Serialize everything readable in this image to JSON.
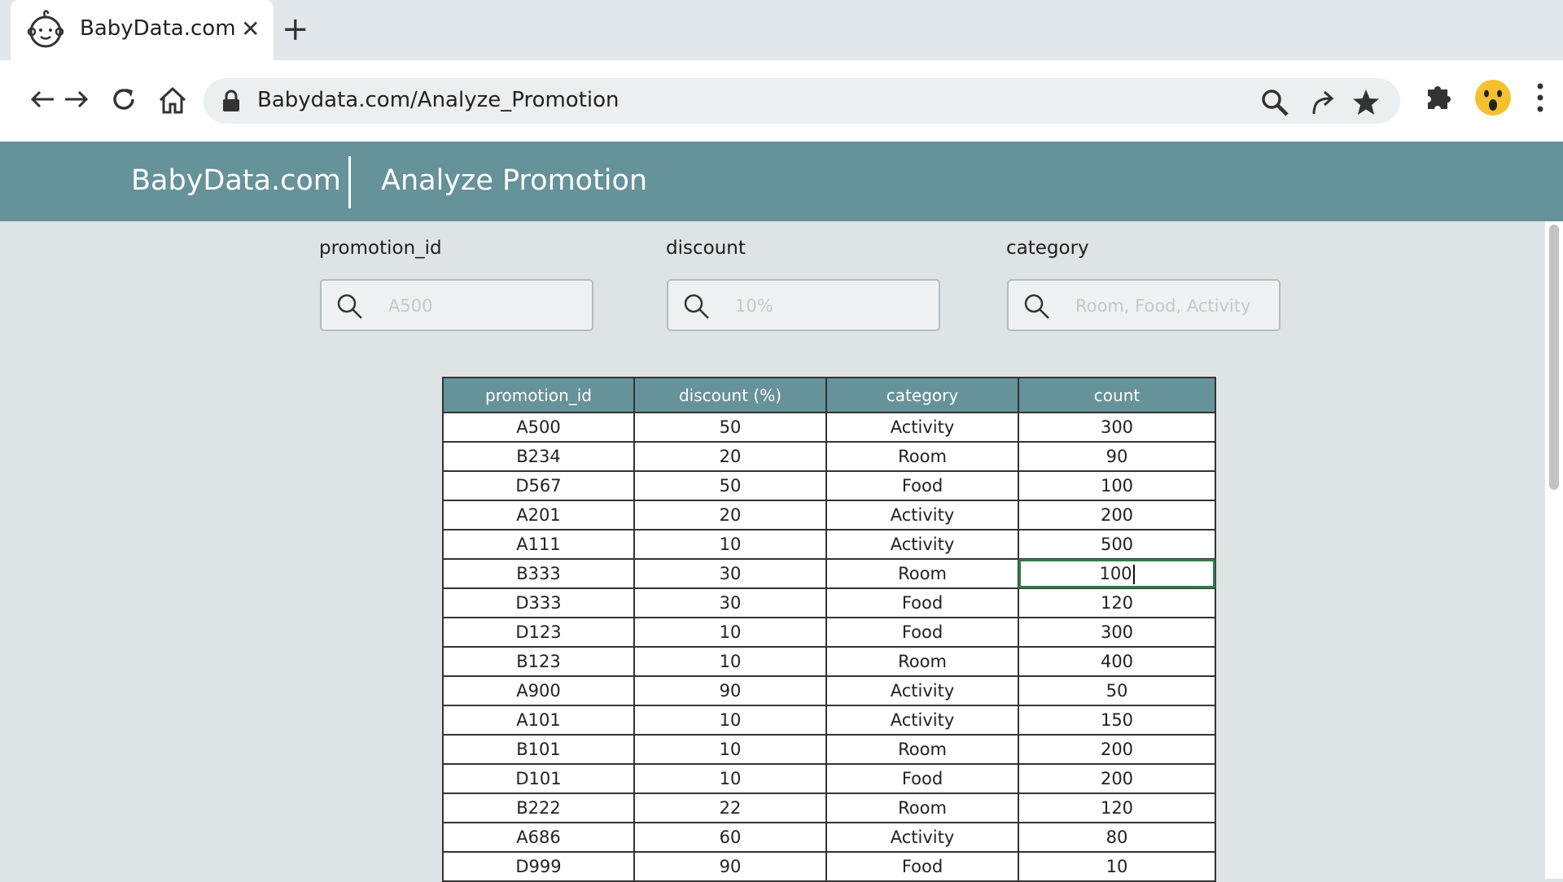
{
  "browser": {
    "tab_title": "BabyData.com",
    "url": "Babydata.com/Analyze_Promotion"
  },
  "header": {
    "brand": "BabyData.com",
    "page_title": "Analyze Promotion"
  },
  "filters": [
    {
      "label": "promotion_id",
      "placeholder": "A500"
    },
    {
      "label": "discount",
      "placeholder": "10%"
    },
    {
      "label": "category",
      "placeholder": "Room, Food, Activity"
    }
  ],
  "table": {
    "columns": [
      "promotion_id",
      "discount (%)",
      "category",
      "count"
    ],
    "rows": [
      [
        "A500",
        "50",
        "Activity",
        "300"
      ],
      [
        "B234",
        "20",
        "Room",
        "90"
      ],
      [
        "D567",
        "50",
        "Food",
        "100"
      ],
      [
        "A201",
        "20",
        "Activity",
        "200"
      ],
      [
        "A111",
        "10",
        "Activity",
        "500"
      ],
      [
        "B333",
        "30",
        "Room",
        "100"
      ],
      [
        "D333",
        "30",
        "Food",
        "120"
      ],
      [
        "D123",
        "10",
        "Food",
        "300"
      ],
      [
        "B123",
        "10",
        "Room",
        "400"
      ],
      [
        "A900",
        "90",
        "Activity",
        "50"
      ],
      [
        "A101",
        "10",
        "Activity",
        "150"
      ],
      [
        "B101",
        "10",
        "Room",
        "200"
      ],
      [
        "D101",
        "10",
        "Food",
        "200"
      ],
      [
        "B222",
        "22",
        "Room",
        "120"
      ],
      [
        "A686",
        "60",
        "Activity",
        "80"
      ],
      [
        "D999",
        "90",
        "Food",
        "10"
      ]
    ]
  },
  "colors": {
    "header_bg": "#66929a",
    "page_bg": "#dee3e5",
    "active_cell_border": "#2e7d4a"
  }
}
